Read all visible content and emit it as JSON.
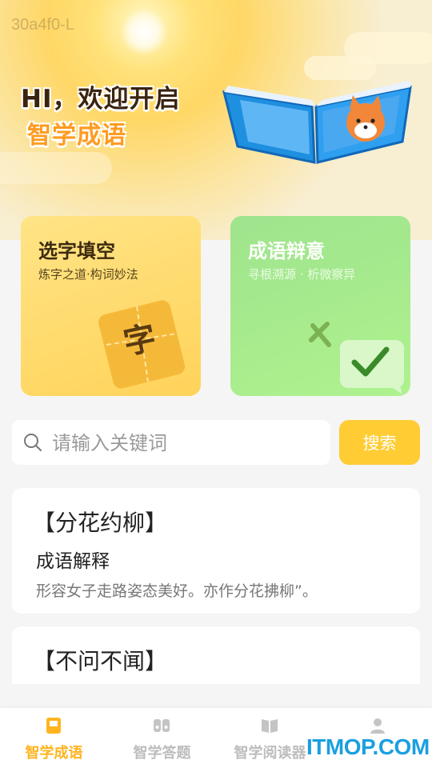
{
  "overlay": {
    "top_code": "30a4f0-L",
    "bottom_watermark": "ITMOP.COM"
  },
  "hero": {
    "headline": "HI，欢迎开启",
    "sub_headline": "智学成语"
  },
  "cards": [
    {
      "title": "选字填空",
      "subtitle": "炼字之道·构词妙法",
      "art_char": "字"
    },
    {
      "title": "成语辩意",
      "subtitle": "寻根溯源 · 析微察异"
    }
  ],
  "search": {
    "placeholder": "请输入关键词",
    "value": "",
    "button_label": "搜索"
  },
  "results": [
    {
      "title": "【分花约柳】",
      "section_label": "成语解释",
      "description": "形容女子走路姿态美好。亦作分花拂柳”。"
    },
    {
      "title": "【不问不闻】"
    }
  ],
  "tabs": [
    {
      "label": "智学成语",
      "icon": "book-icon",
      "active": true
    },
    {
      "label": "智学答题",
      "icon": "quiz-icon",
      "active": false
    },
    {
      "label": "智学阅读器",
      "icon": "reader-icon",
      "active": false
    },
    {
      "label": "",
      "icon": "profile-icon",
      "active": false
    }
  ],
  "colors": {
    "accent": "#ffb41f",
    "search_button": "#ffcc33",
    "card_left": "#ffd35a",
    "card_right": "#aef28f"
  }
}
